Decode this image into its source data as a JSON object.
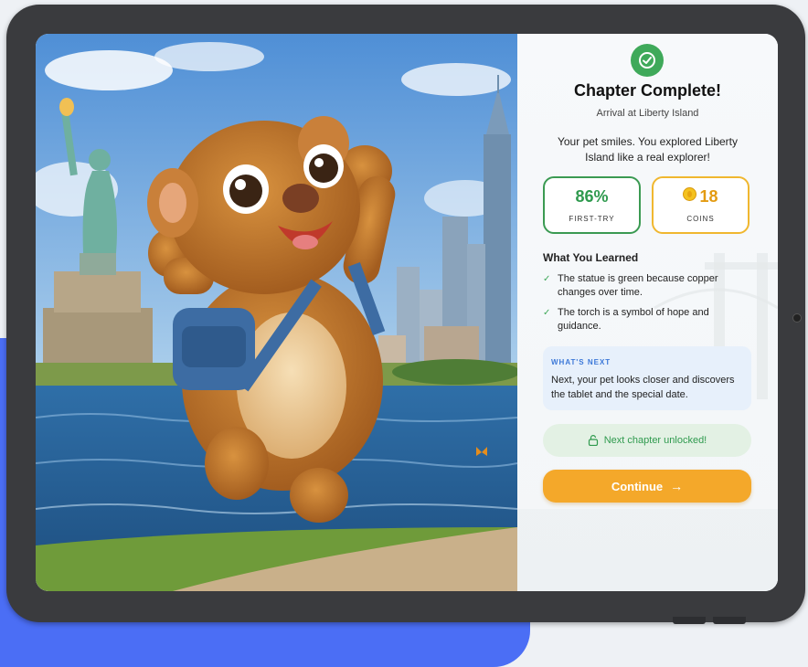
{
  "completion": {
    "title": "Chapter Complete!",
    "subtitle": "Arrival at Liberty Island",
    "message": "Your pet smiles. You explored Liberty Island like a real explorer!"
  },
  "stats": {
    "accuracy": {
      "value": "86%",
      "label": "FIRST-TRY"
    },
    "coins": {
      "value": "18",
      "label": "COINS"
    }
  },
  "learned": {
    "title": "What You Learned",
    "items": [
      "The statue is green because copper changes over time.",
      "The torch is a symbol of hope and guidance."
    ]
  },
  "next": {
    "label": "WHAT'S NEXT",
    "text": "Next, your pet looks closer and discovers the tablet and the special date."
  },
  "unlock": {
    "text": "Next chapter unlocked!"
  },
  "continue_button": {
    "label": "Continue"
  },
  "icons": {
    "badge": "check-circle-icon",
    "coin": "coin-icon",
    "tick": "checkmark-icon",
    "lock": "unlock-icon",
    "continue": "arrow-right-icon"
  },
  "colors": {
    "success": "#3fa95a",
    "coin": "#f0b72f",
    "accent": "#f4a82a",
    "info": "#3c78d8",
    "background_blob": "#4b6ef5"
  }
}
